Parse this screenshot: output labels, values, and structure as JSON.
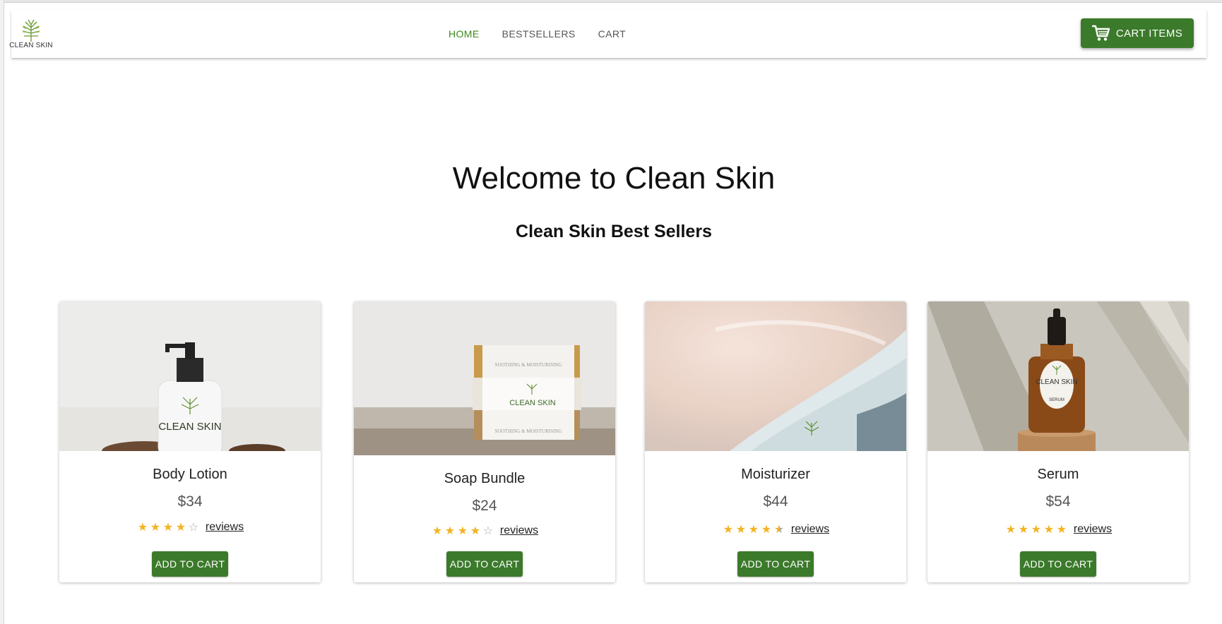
{
  "header": {
    "logo_text": "CLEAN SKIN",
    "nav": [
      {
        "label": "HOME",
        "active": true
      },
      {
        "label": "BESTSELLERS",
        "active": false
      },
      {
        "label": "CART",
        "active": false
      }
    ],
    "cart_button_label": "CART ITEMS"
  },
  "hero": {
    "title": "Welcome to Clean Skin",
    "subtitle": "Clean Skin Best Sellers"
  },
  "products": [
    {
      "name": "Body Lotion",
      "price": "$34",
      "rating": 4,
      "reviews_label": "reviews",
      "add_label": "ADD TO CART",
      "image_label": "CLEAN SKIN"
    },
    {
      "name": "Soap Bundle",
      "price": "$24",
      "rating": 4,
      "reviews_label": "reviews",
      "add_label": "ADD TO CART",
      "image_label": "CLEAN SKIN"
    },
    {
      "name": "Moisturizer",
      "price": "$44",
      "rating": 4.5,
      "reviews_label": "reviews",
      "add_label": "ADD TO CART",
      "image_label": ""
    },
    {
      "name": "Serum",
      "price": "$54",
      "rating": 5,
      "reviews_label": "reviews",
      "add_label": "ADD TO CART",
      "image_label": "CLEAN SKIN",
      "image_sublabel": "SERUM"
    }
  ],
  "colors": {
    "brand_green": "#3b7a2b",
    "active_nav": "#3c8a1e",
    "star": "#f4b323"
  },
  "icons": {
    "cart": "shopping-cart-icon",
    "star": "star-icon",
    "logo": "leaf-logo-icon"
  }
}
